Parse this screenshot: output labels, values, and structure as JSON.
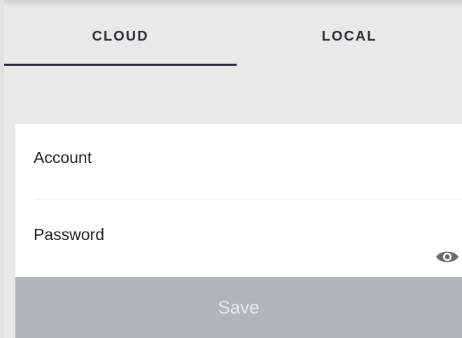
{
  "tabs": [
    {
      "label": "CLOUD",
      "active": true
    },
    {
      "label": "LOCAL",
      "active": false
    }
  ],
  "form": {
    "account_label": "Account",
    "password_label": "Password",
    "password_toggle_icon": "eye-icon",
    "save_label": "Save"
  },
  "colors": {
    "background": "#e9e9e9",
    "tab_indicator": "#1f2a3c",
    "save_button_disabled": "#b0b5bd",
    "eye_icon": "#6b6b6b"
  }
}
